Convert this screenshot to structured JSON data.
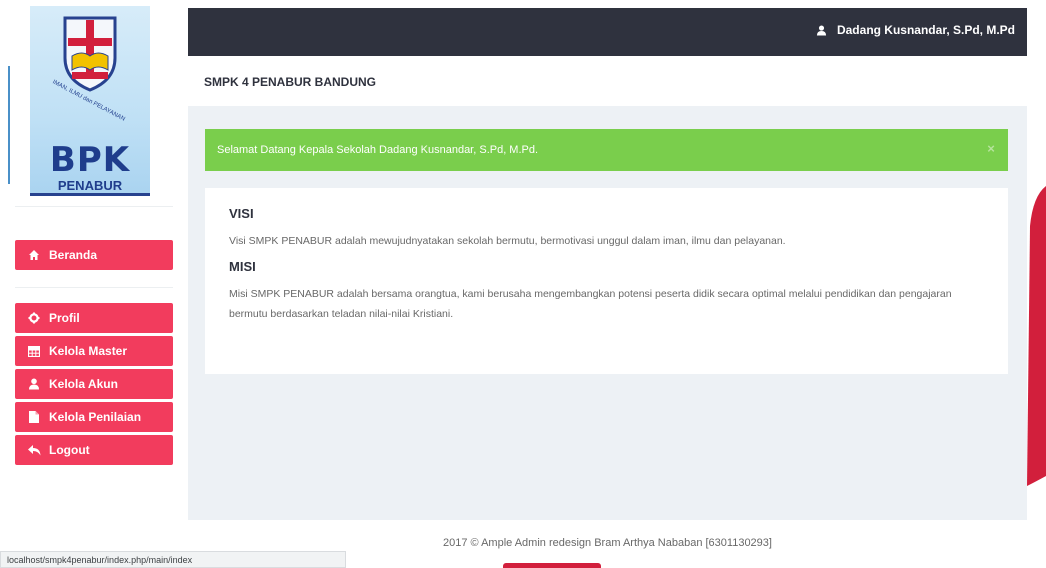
{
  "logo": {
    "title": "BPK",
    "subtitle": "PENABUR",
    "ribbon": "BPK PENABUR",
    "motto": "IMAN, ILMU dan PELAYANAN"
  },
  "sidebar": {
    "items": [
      {
        "label": "Beranda",
        "icon": "home-icon"
      },
      {
        "label": "Profil",
        "icon": "gear-icon"
      },
      {
        "label": "Kelola Master",
        "icon": "table-icon"
      },
      {
        "label": "Kelola Akun",
        "icon": "user-icon"
      },
      {
        "label": "Kelola Penilaian",
        "icon": "file-icon"
      },
      {
        "label": "Logout",
        "icon": "reply-icon"
      }
    ]
  },
  "topbar": {
    "user_name": "Dadang Kusnandar, S.Pd, M.Pd",
    "user_icon": "user-icon"
  },
  "breadcrumb": {
    "title": "SMPK 4 PENABUR BANDUNG"
  },
  "alert": {
    "message": "Selamat Datang Kepala Sekolah Dadang Kusnandar, S.Pd, M.Pd.",
    "close": "×"
  },
  "content": {
    "visi_heading": "VISI",
    "visi_text": "Visi SMPK PENABUR adalah mewujudnyatakan sekolah bermutu, bermotivasi unggul dalam iman, ilmu dan pelayanan.",
    "misi_heading": "MISI",
    "misi_text": "Misi SMPK PENABUR adalah bersama orangtua, kami berusaha mengembangkan potensi peserta didik secara optimal melalui pendidikan dan pengajaran bermutu berdasarkan teladan nilai-nilai Kristiani."
  },
  "footer": {
    "text": "2017 © Ample Admin redesign Bram Arthya Nababan [6301130293]"
  },
  "statusbar": {
    "url": "localhost/smpk4penabur/index.php/main/index"
  },
  "colors": {
    "accent": "#f23c5d",
    "topbar": "#2f323e",
    "alert": "#7ace4c",
    "main_bg": "#edf1f5"
  }
}
